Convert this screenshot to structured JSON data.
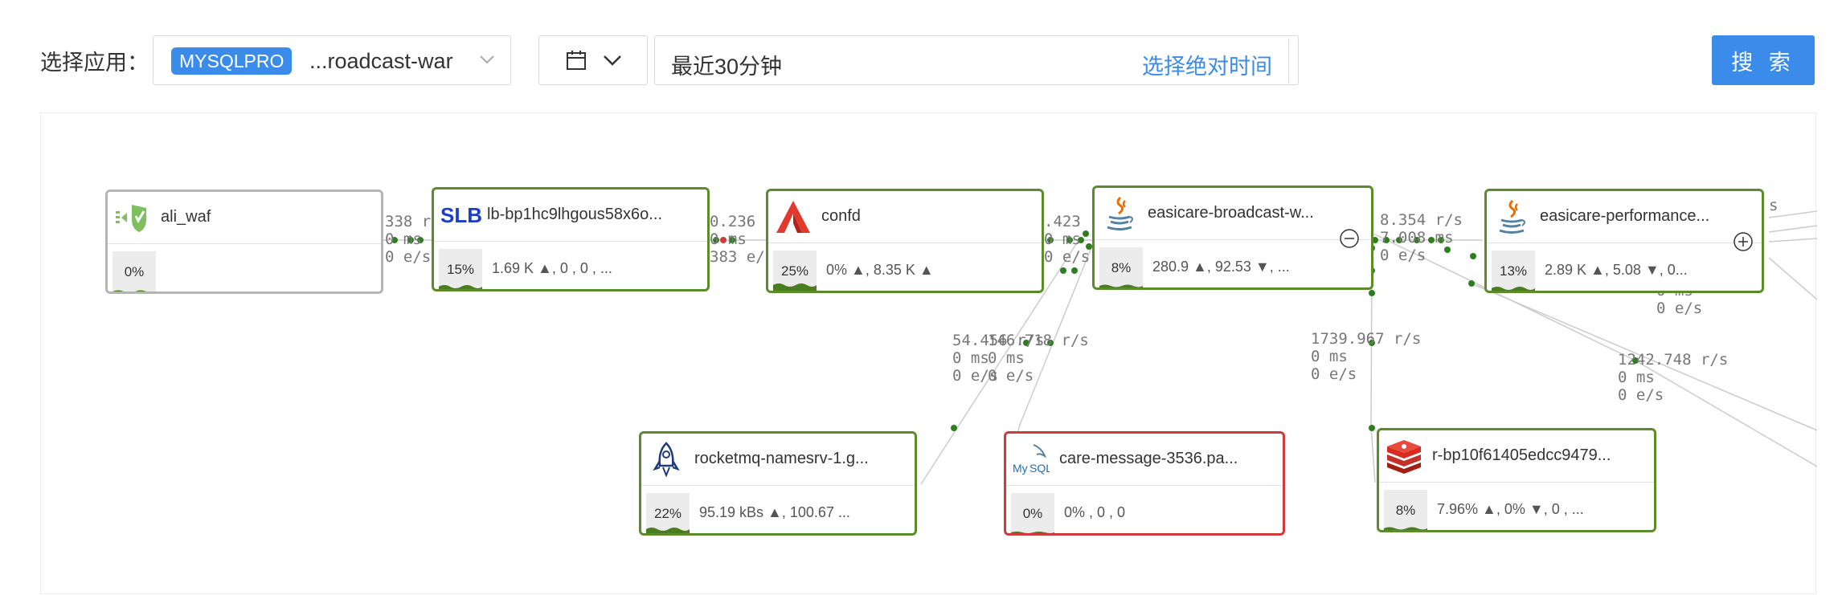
{
  "toolbar": {
    "app_label": "选择应用：",
    "app_tag": "MYSQLPRO",
    "app_value": "...roadcast-war",
    "time_range": "最近30分钟",
    "absolute_time_link": "选择绝对时间",
    "search_label": "搜 索"
  },
  "colors": {
    "accent": "#3b8beb",
    "node_ok": "#5b8c2a",
    "node_error": "#d03a3a",
    "node_inactive": "#b5b5b5",
    "edge": "#cccccc",
    "dot": "#2e7d1f"
  },
  "nodes": [
    {
      "id": "ali_waf",
      "name": "ali_waf",
      "percent": "0%",
      "metrics": "",
      "icon": "waf-icon",
      "status": "inactive"
    },
    {
      "id": "slb",
      "name": "lb-bp1hc9lhgous58x6o...",
      "percent": "15%",
      "metrics": "1.69 K ▲, 0 , 0 , ...",
      "icon": "slb-icon",
      "icon_text": "SLB",
      "status": "ok"
    },
    {
      "id": "confd",
      "name": "confd",
      "percent": "25%",
      "metrics": "0% ▲, 8.35 K ▲",
      "icon": "confd-icon",
      "status": "ok"
    },
    {
      "id": "broadcast",
      "name": "easicare-broadcast-w...",
      "percent": "8%",
      "metrics": "280.9 ▲, 92.53 ▼, ...",
      "icon": "java-icon",
      "status": "ok",
      "control": "collapse"
    },
    {
      "id": "performance",
      "name": "easicare-performance...",
      "percent": "13%",
      "metrics": "2.89 K ▲, 5.08 ▼, 0...",
      "icon": "java-icon",
      "status": "ok",
      "control": "expand"
    },
    {
      "id": "rocketmq",
      "name": "rocketmq-namesrv-1.g...",
      "percent": "22%",
      "metrics": "95.19 kBs ▲, 100.67 ...",
      "icon": "rocketmq-icon",
      "status": "ok"
    },
    {
      "id": "care_message",
      "name": "care-message-3536.pa...",
      "percent": "0%",
      "metrics": "0% , 0 , 0",
      "icon": "mysql-icon",
      "status": "error"
    },
    {
      "id": "redis",
      "name": "r-bp10f61405edcc9479...",
      "percent": "8%",
      "metrics": "7.96% ▲, 0% ▼, 0 , ...",
      "icon": "redis-icon",
      "status": "ok"
    }
  ],
  "edge_labels": [
    {
      "id": "waf-slb",
      "text": "338 r\n0 ms\n0 e/s"
    },
    {
      "id": "slb-confd",
      "text": "0.236 r\n0 ms\n383 e/"
    },
    {
      "id": "confd-broadcast",
      "text": ".423 r\n0 ms\n0 e/s"
    },
    {
      "id": "broadcast-performance",
      "text": "8.354 r/s\n7.008 ms\n0 e/s"
    },
    {
      "id": "confd-rocketmq",
      "text": "54.456 r/s\n0 ms\n0 e/s"
    },
    {
      "id": "confd-caremessage",
      "text": "146.718 r/s\n0 ms\n0 e/s"
    },
    {
      "id": "broadcast-redis",
      "text": "1739.967 r/s\n0 ms\n0 e/s"
    },
    {
      "id": "performance-right",
      "text": "1242.748 r/s\n0 ms\n0 e/s"
    },
    {
      "id": "performance-down",
      "text": "0 ms\n0 e/s"
    },
    {
      "id": "right-edge",
      "text": "s"
    }
  ]
}
